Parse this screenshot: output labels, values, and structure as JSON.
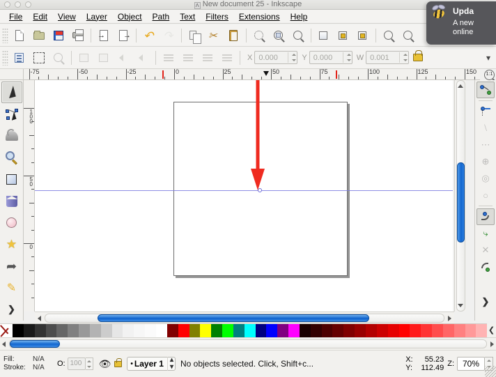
{
  "window": {
    "title": "New document 25 - Inkscape",
    "app_icon": "inkscape-document-icon"
  },
  "menubar": {
    "items": [
      {
        "label": "File",
        "mnemonic": "F"
      },
      {
        "label": "Edit",
        "mnemonic": "E"
      },
      {
        "label": "View",
        "mnemonic": "V"
      },
      {
        "label": "Layer",
        "mnemonic": "L"
      },
      {
        "label": "Object",
        "mnemonic": "O"
      },
      {
        "label": "Path",
        "mnemonic": "P"
      },
      {
        "label": "Text",
        "mnemonic": "T"
      },
      {
        "label": "Filters",
        "mnemonic": "s"
      },
      {
        "label": "Extensions",
        "mnemonic": "x"
      },
      {
        "label": "Help",
        "mnemonic": "H"
      }
    ]
  },
  "notification": {
    "title": "Upda",
    "line1": "A new",
    "line2": "online",
    "icon": "inkscape-bee-icon"
  },
  "command_bar": {
    "buttons": [
      {
        "name": "new-document",
        "icon": "new-page-icon",
        "enabled": true
      },
      {
        "name": "open-document",
        "icon": "folder-open-icon",
        "enabled": true
      },
      {
        "name": "save-document",
        "icon": "floppy-save-icon",
        "enabled": true
      },
      {
        "name": "print-document",
        "icon": "printer-icon",
        "enabled": true
      },
      {
        "name": "import",
        "icon": "import-arrow-icon",
        "enabled": true
      },
      {
        "name": "export",
        "icon": "export-arrow-icon",
        "enabled": true
      },
      {
        "name": "undo",
        "icon": "undo-arrow-icon",
        "enabled": true
      },
      {
        "name": "redo",
        "icon": "redo-arrow-icon",
        "enabled": false
      },
      {
        "name": "copy",
        "icon": "copy-icon",
        "enabled": true
      },
      {
        "name": "cut",
        "icon": "scissors-icon",
        "enabled": true
      },
      {
        "name": "paste",
        "icon": "clipboard-icon",
        "enabled": true
      },
      {
        "name": "zoom-selection",
        "icon": "zoom-selection-icon",
        "enabled": true
      },
      {
        "name": "zoom-drawing",
        "icon": "zoom-drawing-icon",
        "enabled": true
      },
      {
        "name": "zoom-page",
        "icon": "zoom-page-icon",
        "enabled": true
      },
      {
        "name": "duplicate",
        "icon": "duplicate-icon",
        "enabled": true
      },
      {
        "name": "group",
        "icon": "group-icon",
        "enabled": true
      },
      {
        "name": "ungroup",
        "icon": "ungroup-icon",
        "enabled": true
      },
      {
        "name": "xml-editor",
        "icon": "xml-editor-icon",
        "enabled": true
      },
      {
        "name": "document-properties",
        "icon": "document-properties-icon",
        "enabled": true
      }
    ]
  },
  "tool_options_bar": {
    "buttons": [
      {
        "name": "select-all",
        "icon": "select-all-icon",
        "enabled": true
      },
      {
        "name": "select-all-layers",
        "icon": "select-all-layers-icon",
        "enabled": true
      },
      {
        "name": "deselect",
        "icon": "deselect-icon",
        "enabled": false
      },
      {
        "name": "rotate-ccw",
        "icon": "rotate-ccw-icon",
        "enabled": false
      },
      {
        "name": "rotate-cw",
        "icon": "rotate-cw-icon",
        "enabled": false
      },
      {
        "name": "flip-horizontal",
        "icon": "flip-horizontal-icon",
        "enabled": false
      },
      {
        "name": "flip-vertical",
        "icon": "flip-vertical-icon",
        "enabled": false
      },
      {
        "name": "lower-to-bottom",
        "icon": "lower-to-bottom-icon",
        "enabled": false
      },
      {
        "name": "lower",
        "icon": "lower-icon",
        "enabled": false
      },
      {
        "name": "raise",
        "icon": "raise-icon",
        "enabled": false
      },
      {
        "name": "raise-to-top",
        "icon": "raise-to-top-icon",
        "enabled": false
      }
    ],
    "fields": [
      {
        "name": "x-field",
        "label": "X",
        "value": "0.000"
      },
      {
        "name": "y-field",
        "label": "Y",
        "value": "0.000"
      },
      {
        "name": "w-field",
        "label": "W",
        "value": "0.001"
      }
    ],
    "lock_icon": "lock-ratio-icon",
    "overflow_icon": "chevron-down-icon"
  },
  "rulers": {
    "horizontal_labels": [
      "-75",
      "-50",
      "-25",
      "0",
      "25",
      "50",
      "75",
      "100",
      "125",
      "150"
    ],
    "vertical_labels": [
      "100",
      "50",
      "0"
    ],
    "zoom_1to1_icon": "zoom-1-to-1-icon"
  },
  "toolbox": {
    "tools": [
      {
        "name": "selector-tool",
        "icon": "cursor-arrow-icon",
        "active": true
      },
      {
        "name": "node-tool",
        "icon": "node-editor-icon",
        "active": false
      },
      {
        "name": "tweak-tool",
        "icon": "tweak-icon",
        "active": false
      },
      {
        "name": "zoom-tool",
        "icon": "magnifier-icon",
        "active": false
      },
      {
        "name": "rectangle-tool",
        "icon": "rectangle-icon",
        "active": false
      },
      {
        "name": "box3d-tool",
        "icon": "3d-box-icon",
        "active": false
      },
      {
        "name": "ellipse-tool",
        "icon": "ellipse-icon",
        "active": false
      },
      {
        "name": "star-tool",
        "icon": "star-icon",
        "active": false
      },
      {
        "name": "spiral-tool",
        "icon": "spiral-icon",
        "active": false
      },
      {
        "name": "pencil-tool",
        "icon": "pencil-icon",
        "active": false
      },
      {
        "name": "more-tools",
        "icon": "chevron-right-icon",
        "active": false
      }
    ]
  },
  "canvas": {
    "annotation": {
      "type": "red-arrow",
      "direction": "down",
      "color": "#ef2b20"
    },
    "guide": {
      "orientation": "horizontal",
      "color": "#7a7ae0"
    },
    "page": {
      "background": "#ffffff",
      "border": "#6d6d6d"
    }
  },
  "snap_bar": {
    "buttons": [
      {
        "name": "enable-snapping",
        "icon": "snap-master-icon",
        "state": "on"
      },
      {
        "name": "snap-bounding-box",
        "icon": "snap-bbox-icon",
        "state": "normal"
      },
      {
        "name": "snap-bbox-edges",
        "icon": "snap-bbox-edge-icon",
        "state": "dim"
      },
      {
        "name": "snap-bbox-corners",
        "icon": "snap-bbox-corner-icon",
        "state": "dim"
      },
      {
        "name": "snap-bbox-edge-midpoints",
        "icon": "snap-edge-midpoint-icon",
        "state": "dim"
      },
      {
        "name": "snap-bbox-centers",
        "icon": "snap-bbox-center-icon",
        "state": "dim"
      },
      {
        "name": "snap-nodes-paths",
        "icon": "snap-node-icon",
        "state": "on"
      },
      {
        "name": "snap-paths",
        "icon": "snap-path-icon",
        "state": "normal"
      },
      {
        "name": "snap-path-intersections",
        "icon": "snap-intersection-icon",
        "state": "dim"
      },
      {
        "name": "snap-cusp-nodes",
        "icon": "snap-cusp-node-icon",
        "state": "normal"
      },
      {
        "name": "snap-more",
        "icon": "chevron-right-icon",
        "state": "normal"
      }
    ]
  },
  "palette": {
    "none_swatch": "no-color-icon",
    "nav_icon": "chevron-left-icon",
    "colors": [
      "#000000",
      "#1a1a1a",
      "#333333",
      "#4d4d4d",
      "#666666",
      "#808080",
      "#999999",
      "#b3b3b3",
      "#cccccc",
      "#e6e6e6",
      "#f2f2f2",
      "#f7f7f7",
      "#fbfbfb",
      "#ffffff",
      "#800000",
      "#ff0000",
      "#808000",
      "#ffff00",
      "#008000",
      "#00ff00",
      "#008080",
      "#00ffff",
      "#000080",
      "#0000ff",
      "#800080",
      "#ff00ff",
      "#1a0000",
      "#330000",
      "#4d0000",
      "#660000",
      "#800000",
      "#990000",
      "#b30000",
      "#cc0000",
      "#e60000",
      "#ff0000",
      "#ff1a1a",
      "#ff3333",
      "#ff4d4d",
      "#ff6666",
      "#ff8080",
      "#ff9999",
      "#ffb3b3"
    ]
  },
  "statusbar": {
    "fill_label": "Fill:",
    "fill_value": "N/A",
    "stroke_label": "Stroke:",
    "stroke_value": "N/A",
    "opacity_label": "O:",
    "opacity_value": "100",
    "visibility_icon": "eye-icon",
    "lock_icon": "lock-icon",
    "layer_name": "Layer 1",
    "layer_selector_icon": "up-down-chevron-icon",
    "status_message": "No objects selected. Click, Shift+c...",
    "coord_x_label": "X:",
    "coord_x_value": "55.23",
    "coord_y_label": "Y:",
    "coord_y_value": "112.49",
    "zoom_label": "Z:",
    "zoom_value": "70%"
  }
}
